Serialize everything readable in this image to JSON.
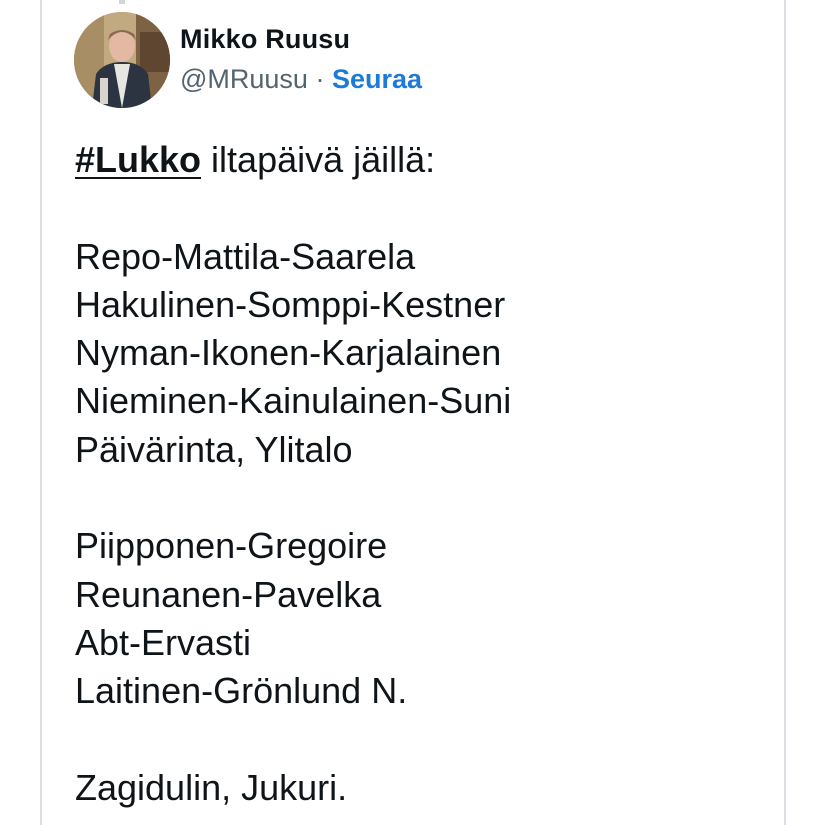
{
  "author": {
    "display_name": "Mikko Ruusu",
    "handle": "@MRuusu",
    "separator": "·",
    "follow_label": "Seuraa"
  },
  "tweet": {
    "hashtag": "#Lukko",
    "intro_rest": " iltapäivä jäillä:",
    "lines": [
      "",
      "Repo-Mattila-Saarela",
      "Hakulinen-Somppi-Kestner",
      "Nyman-Ikonen-Karjalainen",
      "Nieminen-Kainulainen-Suni",
      "Päivärinta, Ylitalo",
      "",
      "Piipponen-Gregoire",
      "Reunanen-Pavelka",
      "Abt-Ervasti",
      "Laitinen-Grönlund N.",
      "",
      "Zagidulin, Jukuri."
    ]
  },
  "colors": {
    "text": "#0f1419",
    "secondary": "#536471",
    "link": "#1d7ad9",
    "border": "#d9dee2"
  },
  "icons": {
    "avatar": "profile-photo"
  }
}
